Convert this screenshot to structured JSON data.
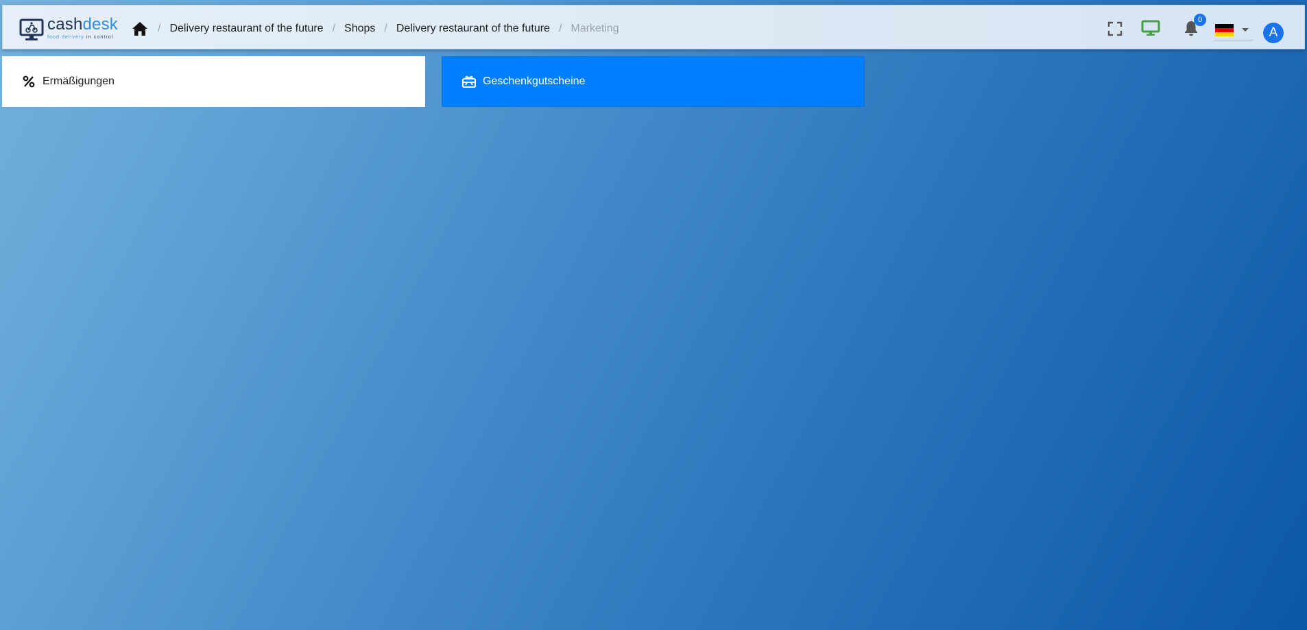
{
  "brand": {
    "word_part1": "cash",
    "word_part2": "desk",
    "tagline_part1": "food delivery",
    "tagline_part2": " in control",
    "icon": "cashdesk-logo-icon",
    "colors": {
      "dark": "#1f3354",
      "accent": "#2f8ee0"
    }
  },
  "breadcrumb": {
    "home_icon": "home-icon",
    "separator": "/",
    "items": [
      {
        "label": "Delivery restaurant of the future"
      },
      {
        "label": "Shops"
      },
      {
        "label": "Delivery restaurant of the future"
      },
      {
        "label": "Marketing",
        "current": true
      }
    ]
  },
  "header_actions": {
    "fullscreen_icon": "fullscreen-icon",
    "display_icon": "monitor-icon",
    "notifications": {
      "icon": "bell-icon",
      "count": "0"
    },
    "language": {
      "flag": "flag-de-icon",
      "selected": "de"
    },
    "user": {
      "initial": "A"
    }
  },
  "cards": [
    {
      "label": "Ermäßigungen",
      "icon": "percent-icon",
      "active": false
    },
    {
      "label": "Geschenkgutscheine",
      "icon": "gift-card-icon",
      "active": true
    }
  ],
  "colors": {
    "active_card": "#0080ff",
    "badge": "#1a73e8",
    "monitor_icon": "#43a047"
  }
}
